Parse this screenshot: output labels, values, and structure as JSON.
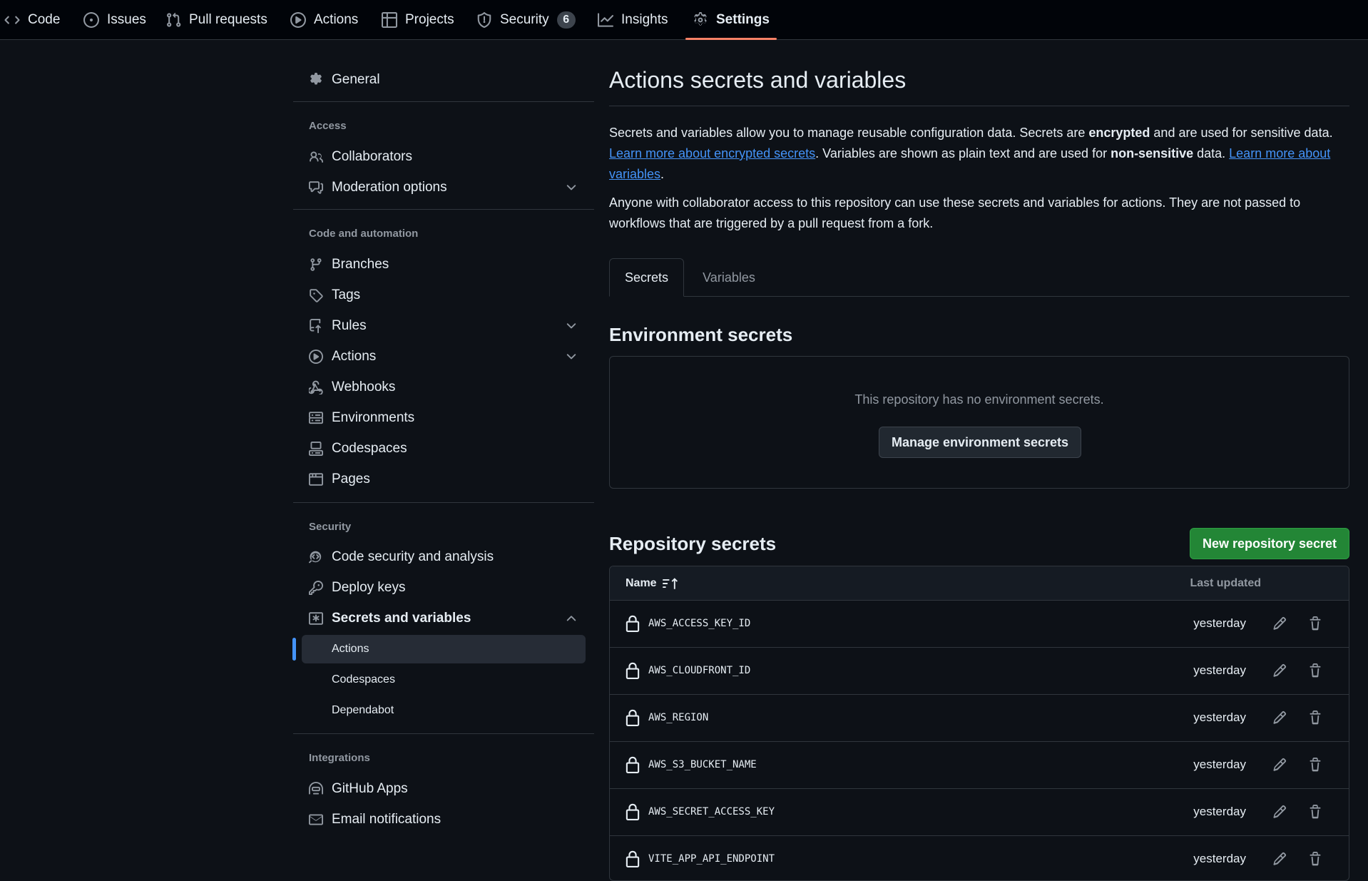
{
  "topnav": {
    "tabs": [
      {
        "label": "Code",
        "icon": "code-icon"
      },
      {
        "label": "Issues",
        "icon": "issue-opened-icon"
      },
      {
        "label": "Pull requests",
        "icon": "git-pull-request-icon"
      },
      {
        "label": "Actions",
        "icon": "play-icon"
      },
      {
        "label": "Projects",
        "icon": "table-icon"
      },
      {
        "label": "Security",
        "icon": "shield-icon",
        "counter": "6"
      },
      {
        "label": "Insights",
        "icon": "graph-icon"
      },
      {
        "label": "Settings",
        "icon": "gear-icon",
        "selected": true
      }
    ],
    "selected_underline_color": "#f78166"
  },
  "sidebar": {
    "general": "General",
    "access": {
      "heading": "Access",
      "items": [
        "Collaborators",
        "Moderation options"
      ]
    },
    "code_automation": {
      "heading": "Code and automation",
      "items": [
        "Branches",
        "Tags",
        "Rules",
        "Actions",
        "Webhooks",
        "Environments",
        "Codespaces",
        "Pages"
      ]
    },
    "security": {
      "heading": "Security",
      "items": [
        "Code security and analysis",
        "Deploy keys",
        "Secrets and variables"
      ],
      "sub_items": [
        "Actions",
        "Codespaces",
        "Dependabot"
      ],
      "active_sub_item": "Actions"
    },
    "integrations": {
      "heading": "Integrations",
      "items": [
        "GitHub Apps",
        "Email notifications"
      ]
    }
  },
  "main": {
    "title": "Actions secrets and variables",
    "desc1": {
      "t1": "Secrets and variables allow you to manage reusable configuration data. Secrets are ",
      "b1": "encrypted",
      "t2": " and are used for sensitive data. ",
      "link1": "Learn more about encrypted secrets",
      "t3": ". Variables are shown as plain text and are used for ",
      "b2": "non-sensitive",
      "t4": " data. ",
      "link2": "Learn more about variables",
      "t5": "."
    },
    "desc2": "Anyone with collaborator access to this repository can use these secrets and variables for actions. They are not passed to workflows that are triggered by a pull request from a fork.",
    "tabs": {
      "secrets": "Secrets",
      "variables": "Variables",
      "selected": "Secrets"
    },
    "env_secrets": {
      "heading": "Environment secrets",
      "empty_text": "This repository has no environment secrets.",
      "manage_button": "Manage environment secrets"
    },
    "repo_secrets": {
      "heading": "Repository secrets",
      "new_button": "New repository secret",
      "columns": {
        "name": "Name",
        "updated": "Last updated"
      },
      "rows": [
        {
          "name": "AWS_ACCESS_KEY_ID",
          "updated": "yesterday"
        },
        {
          "name": "AWS_CLOUDFRONT_ID",
          "updated": "yesterday"
        },
        {
          "name": "AWS_REGION",
          "updated": "yesterday"
        },
        {
          "name": "AWS_S3_BUCKET_NAME",
          "updated": "yesterday"
        },
        {
          "name": "AWS_SECRET_ACCESS_KEY",
          "updated": "yesterday"
        },
        {
          "name": "VITE_APP_API_ENDPOINT",
          "updated": "yesterday"
        }
      ]
    }
  },
  "colors": {
    "background": "#0d1117",
    "accent_blue": "#4493f8",
    "primary_green": "#238636",
    "border": "#30363d",
    "muted_text": "#9198a1"
  }
}
